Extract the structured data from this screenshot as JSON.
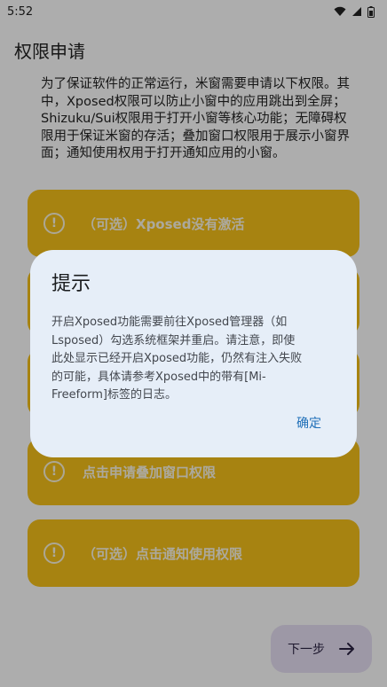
{
  "status": {
    "time": "5:52"
  },
  "page": {
    "title": "权限申请",
    "intro": "为了保证软件的正常运行，米窗需要申请以下权限。其中，Xposed权限可以防止小窗中的应用跳出到全屏；Shizuku/Sui权限用于打开小窗等核心功能；无障碍权限用于保证米窗的存活；叠加窗口权限用于展示小窗界面；通知使用权用于打开通知应用的小窗。"
  },
  "cards": [
    {
      "label": "（可选）Xposed没有激活"
    },
    {
      "label": ""
    },
    {
      "label": ""
    },
    {
      "label": "点击申请叠加窗口权限"
    },
    {
      "label": "（可选）点击通知使用权限"
    }
  ],
  "next_button": {
    "label": "下一步"
  },
  "dialog": {
    "title": "提示",
    "body": "开启Xposed功能需要前往Xposed管理器（如Lsposed）勾选系统框架并重启。请注意，即使此处显示已经开启Xposed功能，仍然有注入失败的可能，具体请参考Xposed中的带有[Mi-Freeform]标签的日志。",
    "confirm": "确定"
  },
  "colors": {
    "card": "#f6c21a",
    "dialog_bg": "#e6eef8",
    "accent": "#1f6fb8"
  }
}
